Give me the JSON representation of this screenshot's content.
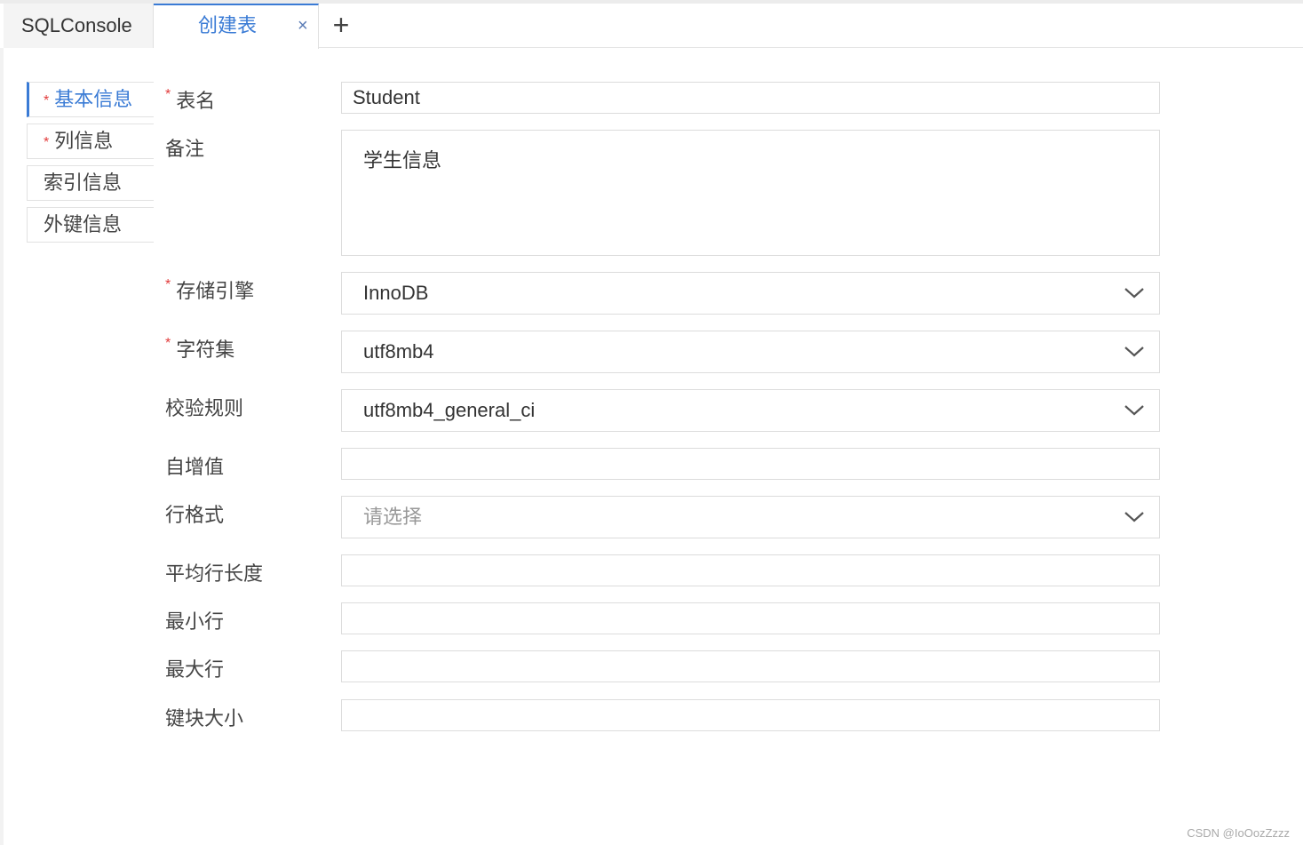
{
  "tabs": {
    "sql_console": "SQLConsole",
    "create_table": "创建表",
    "close_symbol": "×",
    "add_symbol": "+"
  },
  "sidebar": {
    "items": [
      {
        "label": "基本信息",
        "required": true,
        "active": true
      },
      {
        "label": "列信息",
        "required": true,
        "active": false
      },
      {
        "label": "索引信息",
        "required": false,
        "active": false
      },
      {
        "label": "外键信息",
        "required": false,
        "active": false
      }
    ],
    "required_mark": "*"
  },
  "form": {
    "table_name": {
      "label": "表名",
      "value": "Student"
    },
    "comment": {
      "label": "备注",
      "value": "学生信息"
    },
    "engine": {
      "label": "存储引擎",
      "value": "InnoDB"
    },
    "charset": {
      "label": "字符集",
      "value": "utf8mb4"
    },
    "collation": {
      "label": "校验规则",
      "value": "utf8mb4_general_ci"
    },
    "auto_increment": {
      "label": "自增值",
      "value": ""
    },
    "row_format": {
      "label": "行格式",
      "placeholder": "请选择"
    },
    "avg_row_length": {
      "label": "平均行长度",
      "value": ""
    },
    "min_rows": {
      "label": "最小行",
      "value": ""
    },
    "max_rows": {
      "label": "最大行",
      "value": ""
    },
    "key_block_size": {
      "label": "键块大小",
      "value": ""
    }
  },
  "watermark": "CSDN @IoOozZzzz",
  "colors": {
    "accent": "#3a7bd5",
    "required": "#e23c3c"
  }
}
